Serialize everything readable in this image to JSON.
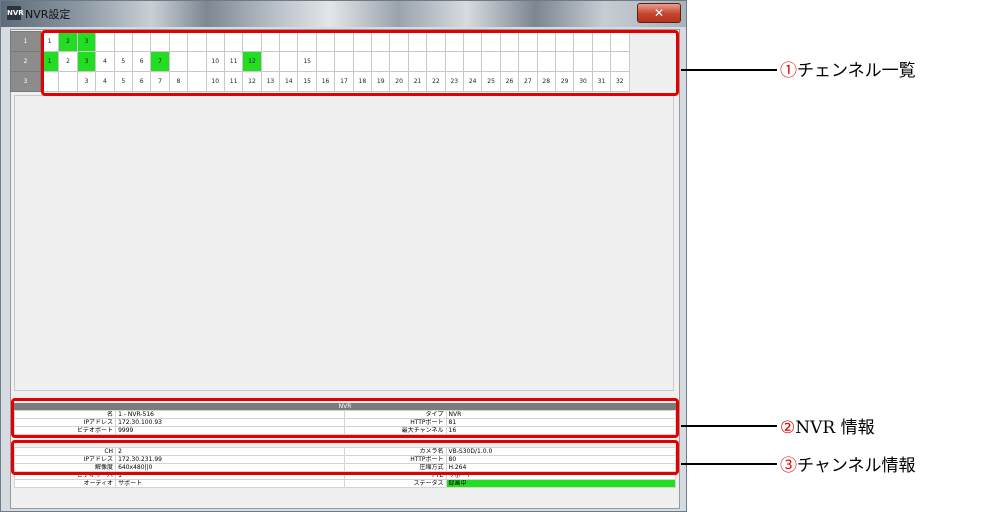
{
  "window": {
    "title": "NVR設定",
    "icon_text": "NVR",
    "close_glyph": "✕"
  },
  "grid": {
    "rows": [
      {
        "head": "1",
        "cells": [
          {
            "t": "1",
            "on": false
          },
          {
            "t": "2",
            "on": true
          },
          {
            "t": "3",
            "on": true
          },
          {
            "t": "",
            "on": false
          },
          {
            "t": "",
            "on": false
          },
          {
            "t": "",
            "on": false
          },
          {
            "t": "",
            "on": false
          },
          {
            "t": "",
            "on": false
          },
          {
            "t": "",
            "on": false
          },
          {
            "t": "",
            "on": false
          },
          {
            "t": "",
            "on": false
          },
          {
            "t": "",
            "on": false
          },
          {
            "t": "",
            "on": false
          },
          {
            "t": "",
            "on": false
          },
          {
            "t": "",
            "on": false
          },
          {
            "t": "",
            "on": false
          },
          {
            "t": "",
            "on": false
          },
          {
            "t": "",
            "on": false
          },
          {
            "t": "",
            "on": false
          },
          {
            "t": "",
            "on": false
          },
          {
            "t": "",
            "on": false
          },
          {
            "t": "",
            "on": false
          },
          {
            "t": "",
            "on": false
          },
          {
            "t": "",
            "on": false
          },
          {
            "t": "",
            "on": false
          },
          {
            "t": "",
            "on": false
          },
          {
            "t": "",
            "on": false
          },
          {
            "t": "",
            "on": false
          },
          {
            "t": "",
            "on": false
          },
          {
            "t": "",
            "on": false
          },
          {
            "t": "",
            "on": false
          },
          {
            "t": "",
            "on": false
          }
        ]
      },
      {
        "head": "2",
        "cells": [
          {
            "t": "1",
            "on": true
          },
          {
            "t": "2",
            "on": false
          },
          {
            "t": "3",
            "on": true
          },
          {
            "t": "4",
            "on": false
          },
          {
            "t": "5",
            "on": false
          },
          {
            "t": "6",
            "on": false
          },
          {
            "t": "7",
            "on": true
          },
          {
            "t": "",
            "on": false
          },
          {
            "t": "",
            "on": false
          },
          {
            "t": "10",
            "on": false
          },
          {
            "t": "11",
            "on": false
          },
          {
            "t": "12",
            "on": true
          },
          {
            "t": "",
            "on": false
          },
          {
            "t": "",
            "on": false
          },
          {
            "t": "15",
            "on": false
          },
          {
            "t": "",
            "on": false
          },
          {
            "t": "",
            "on": false
          },
          {
            "t": "",
            "on": false
          },
          {
            "t": "",
            "on": false
          },
          {
            "t": "",
            "on": false
          },
          {
            "t": "",
            "on": false
          },
          {
            "t": "",
            "on": false
          },
          {
            "t": "",
            "on": false
          },
          {
            "t": "",
            "on": false
          },
          {
            "t": "",
            "on": false
          },
          {
            "t": "",
            "on": false
          },
          {
            "t": "",
            "on": false
          },
          {
            "t": "",
            "on": false
          },
          {
            "t": "",
            "on": false
          },
          {
            "t": "",
            "on": false
          },
          {
            "t": "",
            "on": false
          },
          {
            "t": "",
            "on": false
          }
        ]
      },
      {
        "head": "3",
        "cells": [
          {
            "t": "",
            "on": false
          },
          {
            "t": "",
            "on": false
          },
          {
            "t": "3",
            "on": false
          },
          {
            "t": "4",
            "on": false
          },
          {
            "t": "5",
            "on": false
          },
          {
            "t": "6",
            "on": false
          },
          {
            "t": "7",
            "on": false
          },
          {
            "t": "8",
            "on": false
          },
          {
            "t": "",
            "on": false
          },
          {
            "t": "10",
            "on": false
          },
          {
            "t": "11",
            "on": false
          },
          {
            "t": "12",
            "on": false
          },
          {
            "t": "13",
            "on": false
          },
          {
            "t": "14",
            "on": false
          },
          {
            "t": "15",
            "on": false
          },
          {
            "t": "16",
            "on": false
          },
          {
            "t": "17",
            "on": false
          },
          {
            "t": "18",
            "on": false
          },
          {
            "t": "19",
            "on": false
          },
          {
            "t": "20",
            "on": false
          },
          {
            "t": "21",
            "on": false
          },
          {
            "t": "22",
            "on": false
          },
          {
            "t": "23",
            "on": false
          },
          {
            "t": "24",
            "on": false
          },
          {
            "t": "25",
            "on": false
          },
          {
            "t": "26",
            "on": false
          },
          {
            "t": "27",
            "on": false
          },
          {
            "t": "28",
            "on": false
          },
          {
            "t": "29",
            "on": false
          },
          {
            "t": "30",
            "on": false
          },
          {
            "t": "31",
            "on": false
          },
          {
            "t": "32",
            "on": false
          }
        ]
      }
    ],
    "on_color": "#22dd22"
  },
  "nvr": {
    "header": "NVR",
    "name_label": "名",
    "name_value": "1 - NVR-516",
    "type_label": "タイプ",
    "type_value": "NVR",
    "ip_label": "IPアドレス",
    "ip_value": "172.30.100.93",
    "http_label": "HTTPポート",
    "http_value": "81",
    "video_port_label": "ビデオポート",
    "video_port_value": "9999",
    "max_ch_label": "最大チャンネル",
    "max_ch_value": "16"
  },
  "channel": {
    "ch_label": "CH",
    "ch_value": "2",
    "camera_label": "カメラ名",
    "camera_value": "VB-S30D/1.0.0",
    "ip_label": "IPアドレス",
    "ip_value": "172.30.231.99",
    "http_label": "HTTPポート",
    "http_value": "80",
    "res_label": "解像度",
    "res_value": "640x480||0",
    "codec_label": "圧縮方式",
    "codec_value": "H.264",
    "vserver_label": "ビデオサーバ",
    "vserver_value": "1",
    "ptz_label": "PTZ",
    "ptz_value": "サポート",
    "audio_label": "オーディオ",
    "audio_value": "サポート",
    "status_label": "ステータス",
    "status_value": "録画中"
  },
  "callouts": [
    {
      "num": "①",
      "text": "チェンネル一覧"
    },
    {
      "num": "②",
      "text": "NVR 情報"
    },
    {
      "num": "③",
      "text": "チャンネル情報"
    }
  ],
  "colors": {
    "callout_red": "#e30000",
    "status_green": "#22dd22"
  }
}
